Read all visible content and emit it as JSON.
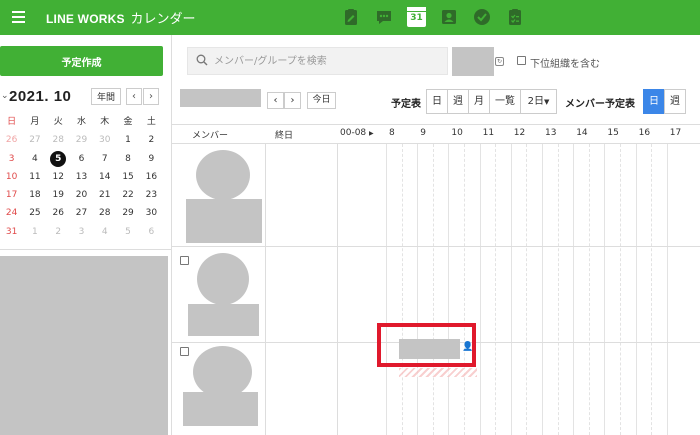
{
  "app": {
    "brand": "LINE WORKS",
    "title": "カレンダー",
    "header_icons": [
      "board-icon",
      "chat-icon",
      "calendar-icon",
      "contacts-icon",
      "task-check-icon",
      "survey-icon"
    ],
    "calendar_icon_day": "31"
  },
  "sidebar": {
    "create_label": "予定作成",
    "mini_calendar": {
      "title": "2021. 10",
      "year_button": "年間",
      "prev": "‹",
      "next": "›",
      "weekdays": [
        "日",
        "月",
        "火",
        "水",
        "木",
        "金",
        "土"
      ],
      "weeks": [
        [
          "26",
          "27",
          "28",
          "29",
          "30",
          "1",
          "2"
        ],
        [
          "3",
          "4",
          "5",
          "6",
          "7",
          "8",
          "9"
        ],
        [
          "10",
          "11",
          "12",
          "13",
          "14",
          "15",
          "16"
        ],
        [
          "17",
          "18",
          "19",
          "20",
          "21",
          "22",
          "23"
        ],
        [
          "24",
          "25",
          "26",
          "27",
          "28",
          "29",
          "30"
        ],
        [
          "31",
          "1",
          "2",
          "3",
          "4",
          "5",
          "6"
        ]
      ],
      "today": "5"
    }
  },
  "toolbar": {
    "search_placeholder": "メンバー/グループを検索",
    "include_sub_label": "下位組織を含む",
    "prev": "‹",
    "next": "›",
    "today_label": "今日",
    "schedule_label": "予定表",
    "view_day": "日",
    "view_week": "週",
    "view_month": "月",
    "view_list": "一覧",
    "view_2day": "2日",
    "member_schedule_label": "メンバー予定表",
    "member_day": "日",
    "member_week": "週"
  },
  "grid": {
    "member_header": "メンバー",
    "allday_header": "終日",
    "range_header": "00-08",
    "hours": [
      "8",
      "9",
      "10",
      "11",
      "12",
      "13",
      "14",
      "15",
      "16",
      "17"
    ]
  },
  "colors": {
    "brand_green": "#41b035",
    "active_blue": "#3b86e8",
    "highlight_red": "#e0192c",
    "sunday_red": "#e04a4a"
  }
}
